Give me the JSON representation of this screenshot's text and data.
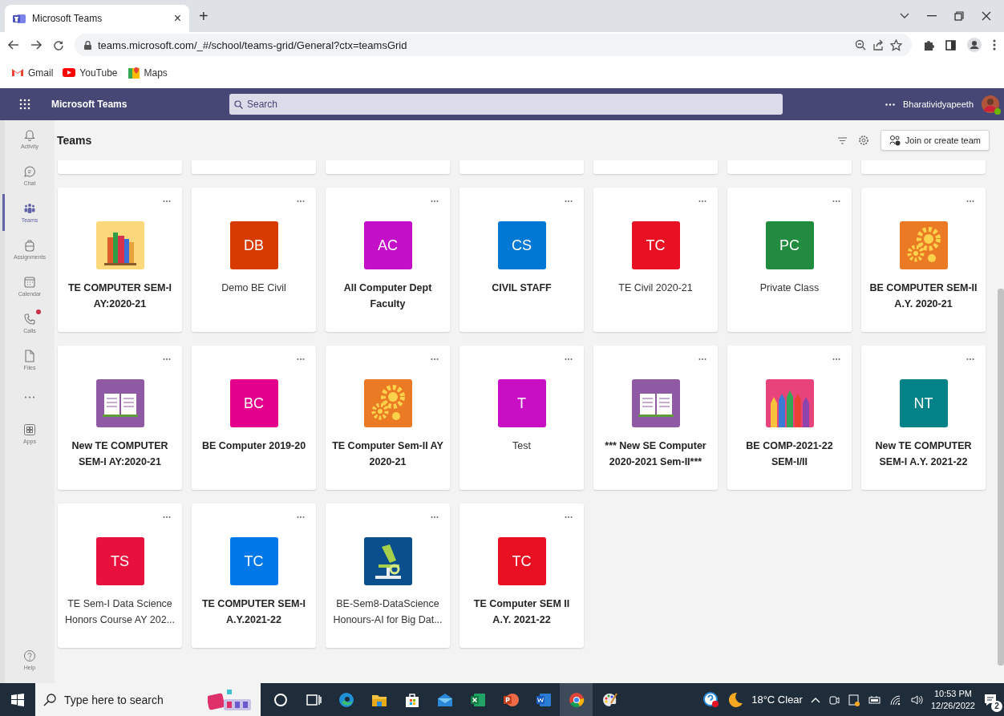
{
  "browser": {
    "tab_title": "Microsoft Teams",
    "tab_close": "×",
    "new_tab": "+",
    "url": "teams.microsoft.com/_#/school/teams-grid/General?ctx=teamsGrid",
    "bookmarks": [
      {
        "label": "Gmail",
        "kind": "gmail"
      },
      {
        "label": "YouTube",
        "kind": "youtube"
      },
      {
        "label": "Maps",
        "kind": "maps"
      }
    ]
  },
  "app_bar": {
    "app_name": "Microsoft Teams",
    "search_placeholder": "Search",
    "user_name": "Bharatividyapeeth"
  },
  "rail": [
    {
      "label": "Activity",
      "kind": "bell",
      "selected": false,
      "badge": false
    },
    {
      "label": "Chat",
      "kind": "chat",
      "selected": false,
      "badge": false
    },
    {
      "label": "Teams",
      "kind": "teams",
      "selected": true,
      "badge": false
    },
    {
      "label": "Assignments",
      "kind": "backpack",
      "selected": false,
      "badge": false
    },
    {
      "label": "Calendar",
      "kind": "calendar",
      "selected": false,
      "badge": false
    },
    {
      "label": "Calls",
      "kind": "phone",
      "selected": false,
      "badge": true
    },
    {
      "label": "Files",
      "kind": "file",
      "selected": false,
      "badge": false
    },
    {
      "kind": "more",
      "selected": false,
      "badge": false
    },
    {
      "label": "Apps",
      "kind": "apps",
      "selected": false,
      "badge": false
    }
  ],
  "help": "Help",
  "page": {
    "title": "Teams",
    "join_button": "Join or create team"
  },
  "teams": [
    {
      "name": "TE COMPUTER SEM-I AY:2020-21",
      "unread": true,
      "avatar": {
        "kind": "books"
      }
    },
    {
      "name": "Demo BE Civil",
      "unread": false,
      "avatar": {
        "kind": "initials",
        "text": "DB",
        "color": "#d83b01"
      }
    },
    {
      "name": "All Computer Dept Faculty",
      "unread": true,
      "avatar": {
        "kind": "initials",
        "text": "AC",
        "color": "#c30fc8"
      }
    },
    {
      "name": "CIVIL STAFF",
      "unread": true,
      "avatar": {
        "kind": "initials",
        "text": "CS",
        "color": "#0078d4"
      }
    },
    {
      "name": "TE Civil 2020-21",
      "unread": false,
      "avatar": {
        "kind": "initials",
        "text": "TC",
        "color": "#e81123"
      }
    },
    {
      "name": "Private Class",
      "unread": false,
      "avatar": {
        "kind": "initials",
        "text": "PC",
        "color": "#218b3f"
      }
    },
    {
      "name": "BE COMPUTER SEM-II A.Y. 2020-21",
      "unread": true,
      "avatar": {
        "kind": "gears"
      }
    },
    {
      "name": "New TE COMPUTER SEM-I AY:2020-21",
      "unread": true,
      "avatar": {
        "kind": "book"
      }
    },
    {
      "name": "BE Computer 2019-20",
      "unread": true,
      "avatar": {
        "kind": "initials",
        "text": "BC",
        "color": "#e3008c"
      }
    },
    {
      "name": "TE Computer Sem-II AY 2020-21",
      "unread": true,
      "avatar": {
        "kind": "gears"
      }
    },
    {
      "name": "Test",
      "unread": false,
      "avatar": {
        "kind": "initials",
        "text": "T",
        "color": "#c80fc4"
      }
    },
    {
      "name": "*** New SE Computer 2020-2021 Sem-II***",
      "unread": true,
      "avatar": {
        "kind": "book"
      }
    },
    {
      "name": "BE COMP-2021-22 SEM-I/II",
      "unread": true,
      "avatar": {
        "kind": "pencils"
      }
    },
    {
      "name": "New TE COMPUTER SEM-I A.Y. 2021-22",
      "unread": true,
      "avatar": {
        "kind": "initials",
        "text": "NT",
        "color": "#038387"
      }
    },
    {
      "name": "TE Sem-I Data Science Honors Course AY 202...",
      "unread": false,
      "avatar": {
        "kind": "initials",
        "text": "TS",
        "color": "#e8113d"
      }
    },
    {
      "name": "TE COMPUTER SEM-I A.Y.2021-22",
      "unread": true,
      "avatar": {
        "kind": "initials",
        "text": "TC",
        "color": "#0078e8"
      }
    },
    {
      "name": "BE-Sem8-DataScience Honours-AI for Big Dat...",
      "unread": false,
      "avatar": {
        "kind": "microscope"
      }
    },
    {
      "name": "TE Computer SEM II A.Y. 2021-22",
      "unread": true,
      "avatar": {
        "kind": "initials",
        "text": "TC",
        "color": "#e81123"
      }
    }
  ],
  "taskbar": {
    "search_placeholder": "Type here to search",
    "weather": "18°C Clear",
    "time": "10:53 PM",
    "date": "12/26/2022",
    "notifications": "2"
  }
}
